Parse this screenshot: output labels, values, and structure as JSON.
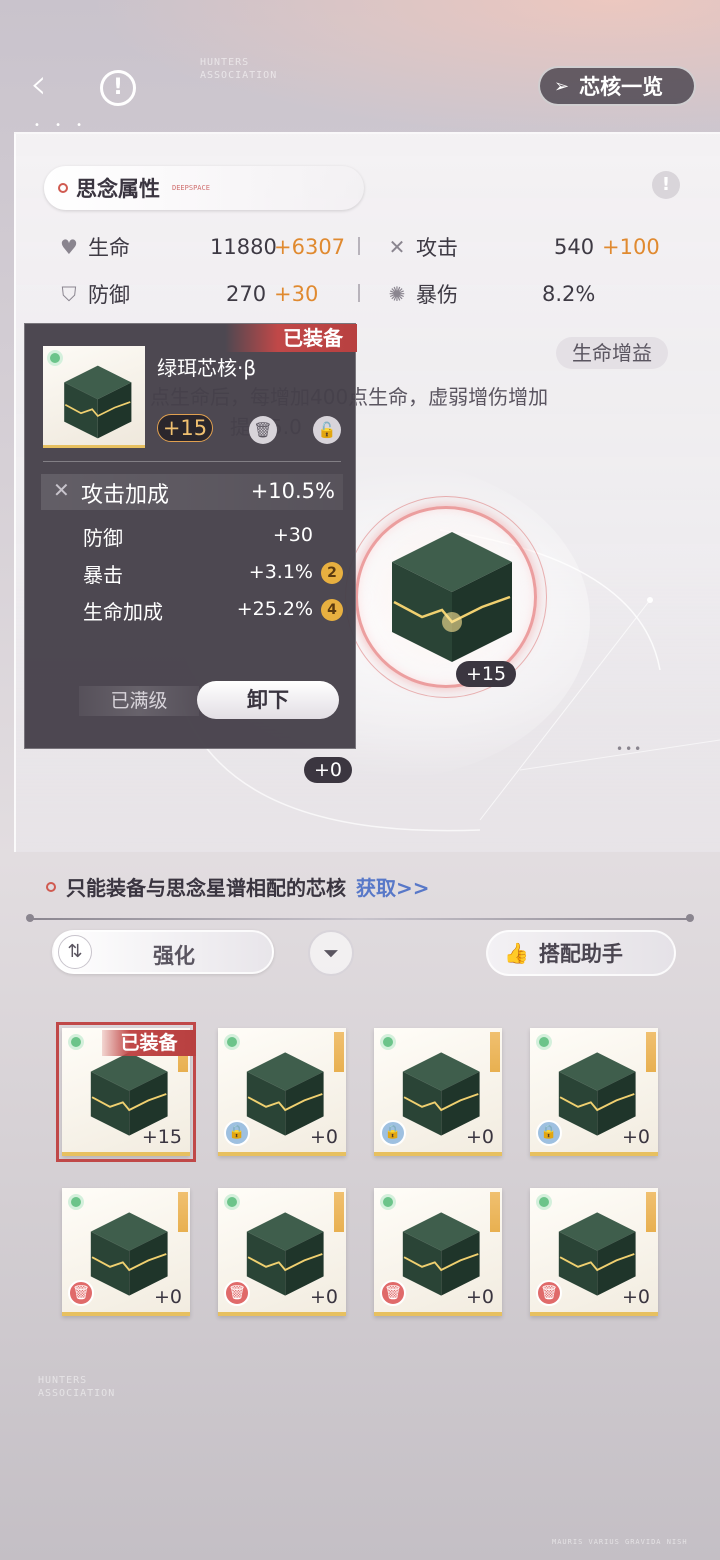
{
  "header": {
    "codex_label": "芯核一览",
    "codex_icon": "send-arrow-icon"
  },
  "attributes": {
    "title": "思念属性",
    "title_tag": "DEEPSPACE",
    "stats": [
      {
        "label": "生命",
        "base": "11880",
        "bonus": "+6307",
        "icon": "heart-icon"
      },
      {
        "label": "攻击",
        "base": "540",
        "bonus": "+100",
        "icon": "crossed-swords-icon"
      },
      {
        "label": "防御",
        "base": "270",
        "bonus": "+30",
        "icon": "shield-icon"
      },
      {
        "label": "暴伤",
        "base": "8.2%",
        "bonus": "",
        "icon": "burst-icon"
      }
    ],
    "gain_tag": "生命增益",
    "desc_line1": "点生命后，每增加400点生命，虚弱增伤增加",
    "desc_line2": "提升5.0"
  },
  "slots": {
    "center_level": "+15",
    "left_level": "+0"
  },
  "popup": {
    "equipped_label": "已装备",
    "name": "绿珥芯核·β",
    "level": "+15",
    "main_stat": {
      "label": "攻击加成",
      "value": "+10.5%"
    },
    "sub_stats": [
      {
        "label": "防御",
        "value": "+30",
        "upgrades": ""
      },
      {
        "label": "暴击",
        "value": "+3.1%",
        "upgrades": "2"
      },
      {
        "label": "生命加成",
        "value": "+25.2%",
        "upgrades": "4"
      }
    ],
    "maxed_label": "已满级",
    "unequip_label": "卸下"
  },
  "bottom": {
    "match_text": "只能装备与思念星谱相配的芯核",
    "acquire_link": "获取>>",
    "sort_label": "强化",
    "assist_label": "搭配助手"
  },
  "inventory": [
    {
      "level": "+15",
      "equipped": true,
      "equipped_label": "已装备",
      "badge": "none"
    },
    {
      "level": "+0",
      "equipped": false,
      "badge": "lock"
    },
    {
      "level": "+0",
      "equipped": false,
      "badge": "lock"
    },
    {
      "level": "+0",
      "equipped": false,
      "badge": "lock"
    },
    {
      "level": "+0",
      "equipped": false,
      "badge": "trash"
    },
    {
      "level": "+0",
      "equipped": false,
      "badge": "trash"
    },
    {
      "level": "+0",
      "equipped": false,
      "badge": "trash"
    },
    {
      "level": "+0",
      "equipped": false,
      "badge": "trash"
    }
  ],
  "watermark": {
    "top_line1": "HUNTERS",
    "top_line2": "ASSOCIATION",
    "bottom_line1": "HUNTERS",
    "bottom_line2": "ASSOCIATION",
    "footer": "MAURIS VARIUS GRAVIDA NISH"
  },
  "colors": {
    "bonus": "#e08a30",
    "link": "#5878c8",
    "equipped_red": "#c04848"
  }
}
